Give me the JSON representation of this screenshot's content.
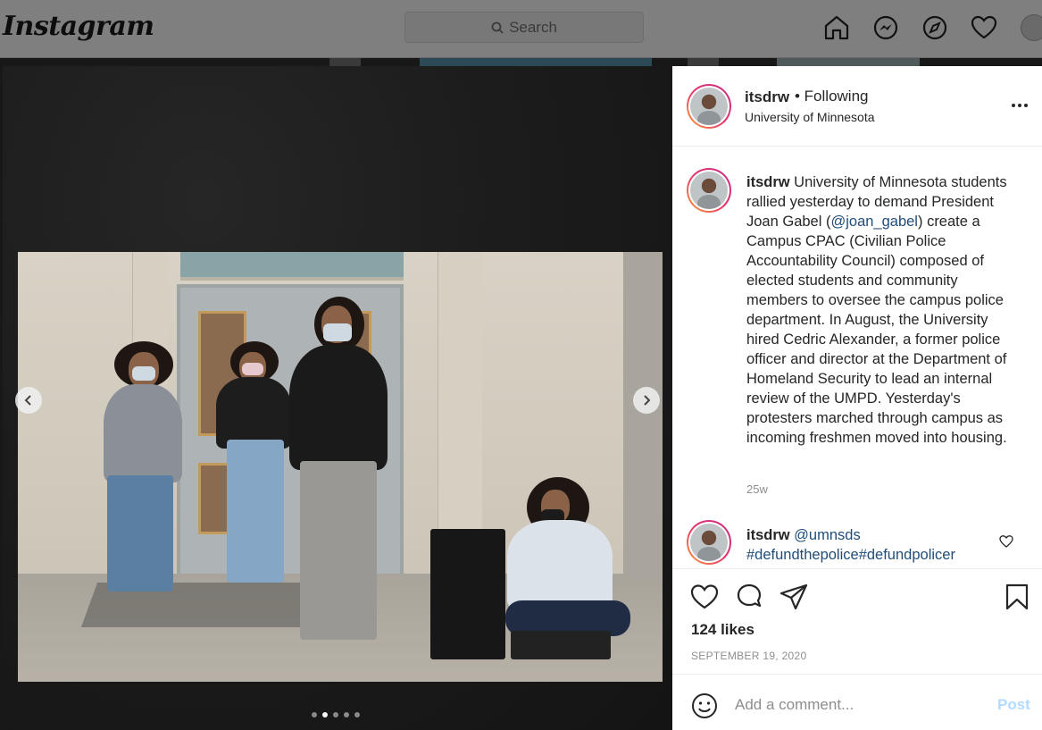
{
  "topbar": {
    "logo": "Instagram",
    "search_placeholder": "Search",
    "icons": [
      "home-icon",
      "messenger-icon",
      "explore-icon",
      "activity-heart-icon",
      "profile-avatar"
    ]
  },
  "post": {
    "username": "itsdrw",
    "follow_status": "• Following",
    "location": "University of Minnesota",
    "carousel": {
      "total_slides": 5,
      "active_slide": 2
    },
    "caption": {
      "username": "itsdrw",
      "text_before_mention": " University of Minnesota students rallied yesterday to demand President Joan Gabel (",
      "mention": "@joan_gabel",
      "text_after_mention": ") create a Campus CPAC (Civilian Police Accountability Council) composed of elected students and community members to oversee the campus police department. In August, the University hired Cedric Alexander, a former police officer and director at the Department of Homeland Security to lead an internal review of the UMPD. Yesterday's protesters marched through campus as incoming freshmen moved into housing.",
      "time_ago": "25w"
    },
    "comment": {
      "username": "itsdrw",
      "mention": " @umnsds",
      "hashtags": "#defundthepolice#defundpolicer"
    },
    "likes": "124 likes",
    "date": "SEPTEMBER 19, 2020",
    "add_comment_placeholder": "Add a comment...",
    "post_label": "Post"
  },
  "colors": {
    "link": "#1f4d7a",
    "post_button_disabled": "#b3dbff",
    "secondary_text": "#8e8e8e"
  }
}
